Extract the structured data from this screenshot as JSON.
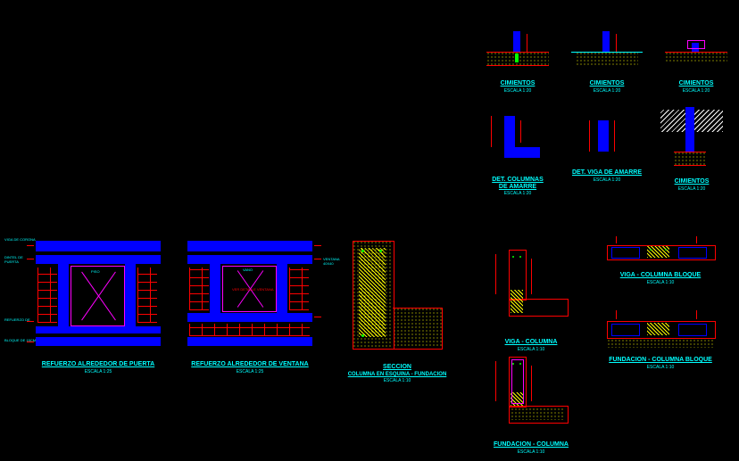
{
  "details": {
    "cimientos1": {
      "title": "CIMIENTOS",
      "scale": "ESCALA 1:20"
    },
    "cimientos2": {
      "title": "CIMIENTOS",
      "scale": "ESCALA 1:20"
    },
    "cimientos3": {
      "title": "CIMIENTOS",
      "scale": "ESCALA 1:20"
    },
    "cimientos4": {
      "title": "CIMIENTOS",
      "scale": "ESCALA 1:20"
    },
    "det_columnas": {
      "title": "DET. COLUMNAS",
      "subtitle": "DE AMARRE",
      "scale": "ESCALA 1:20"
    },
    "det_viga": {
      "title": "DET. VIGA DE AMARRE",
      "scale": "ESCALA 1:20"
    },
    "refuerzo_puerta": {
      "title": "REFUERZO ALREDEDOR DE PUERTA",
      "scale": "ESCALA 1:25"
    },
    "refuerzo_ventana": {
      "title": "REFUERZO ALREDEDOR DE VENTANA",
      "scale": "ESCALA 1:25"
    },
    "seccion": {
      "title": "SECCION",
      "subtitle": "COLUMNA EN ESQUINA - FUNDACION",
      "scale": "ESCALA 1:10"
    },
    "viga_columna": {
      "title": "VIGA - COLUMNA",
      "scale": "ESCALA 1:10"
    },
    "viga_columna_bloque": {
      "title": "VIGA - COLUMNA BLOQUE",
      "scale": "ESCALA 1:10"
    },
    "fundacion_columna": {
      "title": "FUNDACION - COLUMNA",
      "scale": "ESCALA 1:10"
    },
    "fundacion_columna_bloque": {
      "title": "FUNDACION - COLUMNA BLOQUE",
      "scale": "ESCALA 1:10"
    }
  },
  "annotations": {
    "viga_corona": "VIGA DE CORONA",
    "dintel": "DINTEL DE",
    "dintel2": "PUERTA",
    "ventana_label": "VENTANA 40X40",
    "refuerzo": "REFUERZO DE",
    "refuerzo2": "BLOQUE DE 15CM",
    "piso": "PISO",
    "vano": "VANO",
    "ver_detalle": "VER DETALLE VENTANA"
  }
}
